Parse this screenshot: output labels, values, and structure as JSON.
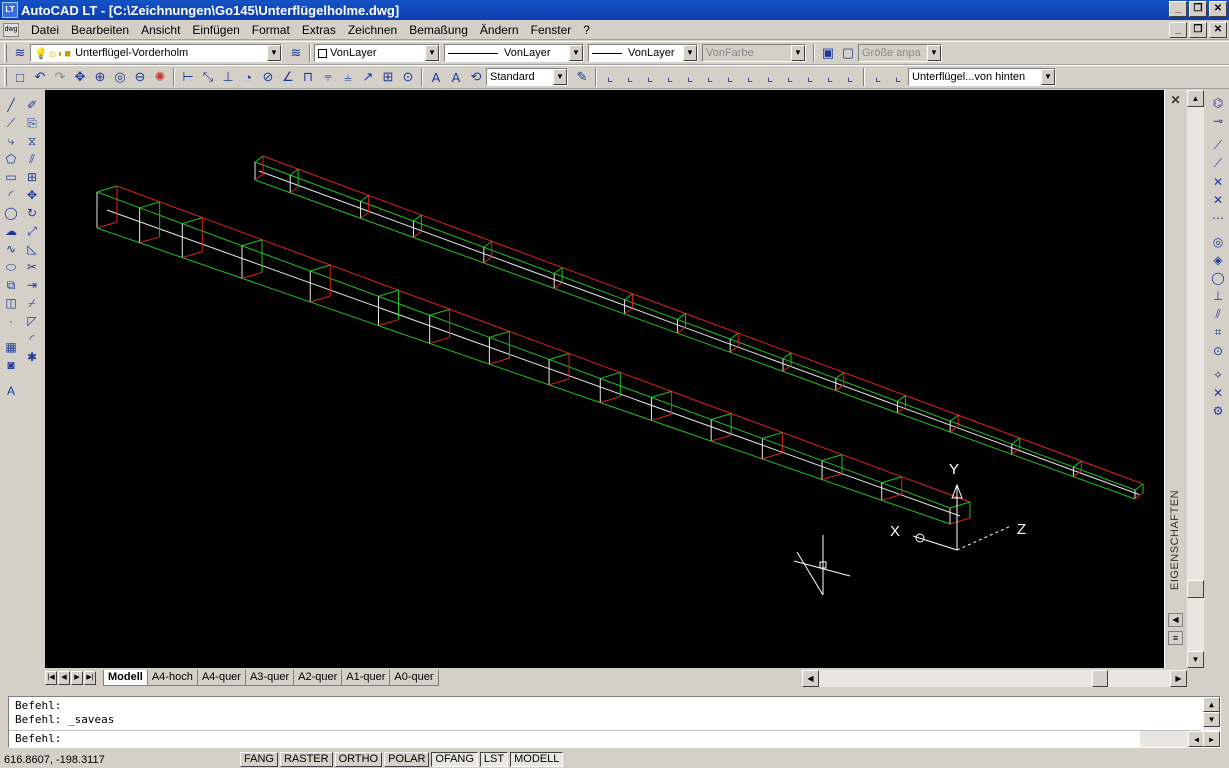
{
  "window": {
    "title": "AutoCAD LT - [C:\\Zeichnungen\\Go145\\Unterflügelholme.dwg]",
    "app_icon": "LT"
  },
  "menu": [
    "Datei",
    "Bearbeiten",
    "Ansicht",
    "Einfügen",
    "Format",
    "Extras",
    "Zeichnen",
    "Bemaßung",
    "Ändern",
    "Fenster",
    "?"
  ],
  "toolbar_layers": {
    "layer_value": "Unterflügel-Vorderholm",
    "color_value": "VonLayer",
    "linetype_value": "VonLayer",
    "lineweight_value": "VonLayer",
    "plotstyle_value": "VonFarbe",
    "size_value": "Größe anpa"
  },
  "toolbar_standard": {
    "textstyle_value": "Standard",
    "view_value": "Unterflügel...von hinten"
  },
  "properties_panel": {
    "label": "EIGENSCHAFTEN"
  },
  "canvas": {
    "ucs_x": "X",
    "ucs_y": "Y",
    "ucs_z": "Z"
  },
  "layout_tabs": [
    "Modell",
    "A4-hoch",
    "A4-quer",
    "A3-quer",
    "A2-quer",
    "A1-quer",
    "A0-quer"
  ],
  "active_tab": "Modell",
  "command_history": [
    "Befehl:",
    "Befehl: _saveas",
    "Befehl:"
  ],
  "status": {
    "coordinates": "616.8607,  -198.3117",
    "buttons": [
      "FANG",
      "RASTER",
      "ORTHO",
      "POLAR",
      "OFANG",
      "LST",
      "MODELL"
    ],
    "active_buttons": [
      "OFANG",
      "LST",
      "MODELL"
    ]
  },
  "colors": {
    "canvas_bg": "#000000",
    "edge_red": "#e02020",
    "edge_green": "#20c020",
    "edge_white": "#e8e8e8",
    "title_blue": "#0a3db0"
  },
  "icons": {
    "draw_tools": [
      "line-icon",
      "construction-line-icon",
      "polyline-icon",
      "polygon-icon",
      "rectangle-icon",
      "arc-icon",
      "circle-icon",
      "revision-cloud-icon",
      "spline-icon",
      "ellipse-icon",
      "insert-block-icon",
      "make-block-icon",
      "point-icon",
      "hatch-icon",
      "region-icon",
      "mtext-icon"
    ],
    "modify_tools": [
      "erase-icon",
      "copy-icon",
      "mirror-icon",
      "offset-icon",
      "array-icon",
      "move-icon",
      "rotate-icon",
      "scale-icon",
      "stretch-icon",
      "trim-icon",
      "extend-icon",
      "break-icon",
      "chamfer-icon",
      "fillet-icon",
      "explode-icon"
    ],
    "osnap_tools": [
      "temp-track-icon",
      "snap-from-icon",
      "snap-endpoint-icon",
      "snap-midpoint-icon",
      "snap-intersection-icon",
      "snap-apparent-icon",
      "snap-extension-icon",
      "snap-center-icon",
      "snap-quadrant-icon",
      "snap-tangent-icon",
      "snap-perpendicular-icon",
      "snap-parallel-icon",
      "snap-insert-icon",
      "snap-node-icon",
      "snap-nearest-icon",
      "snap-none-icon",
      "osnap-settings-icon"
    ]
  }
}
